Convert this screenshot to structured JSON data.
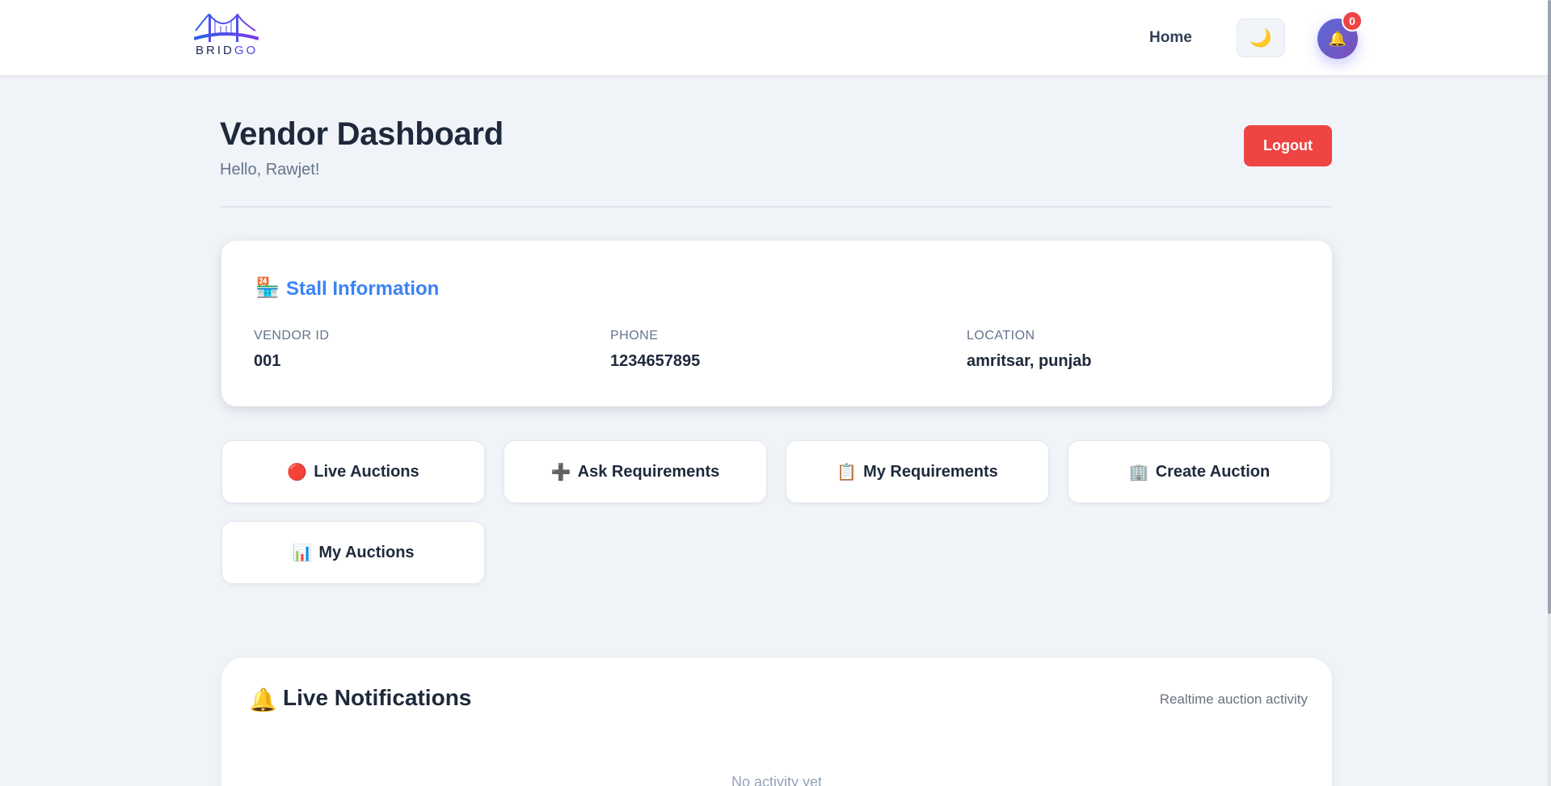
{
  "navbar": {
    "logo_text_a": "BRID",
    "logo_text_b": "GO",
    "home_label": "Home",
    "theme_icon": "🌙",
    "bell_icon": "🔔",
    "notification_count": "0"
  },
  "header": {
    "title": "Vendor Dashboard",
    "greeting": "Hello, Rawjet!",
    "logout_label": "Logout"
  },
  "stall": {
    "icon": "🏪",
    "title": "Stall Information",
    "fields": [
      {
        "label": "VENDOR ID",
        "value": "001"
      },
      {
        "label": "PHONE",
        "value": "1234657895"
      },
      {
        "label": "LOCATION",
        "value": "amritsar, punjab"
      }
    ]
  },
  "actions": [
    {
      "icon": "🔴",
      "label": "Live Auctions"
    },
    {
      "icon": "➕",
      "label": "Ask Requirements"
    },
    {
      "icon": "📋",
      "label": "My Requirements"
    },
    {
      "icon": "🏢",
      "label": "Create Auction"
    },
    {
      "icon": "📊",
      "label": "My Auctions"
    }
  ],
  "notifications": {
    "icon": "🔔",
    "title": "Live Notifications",
    "subtitle": "Realtime auction activity",
    "empty_text": "No activity yet"
  },
  "colors": {
    "accent": "#3b82f6",
    "danger": "#ef4444",
    "background": "#f0f3f8",
    "bell_gradient_start": "#5b6cd9",
    "bell_gradient_end": "#7c4dba"
  }
}
